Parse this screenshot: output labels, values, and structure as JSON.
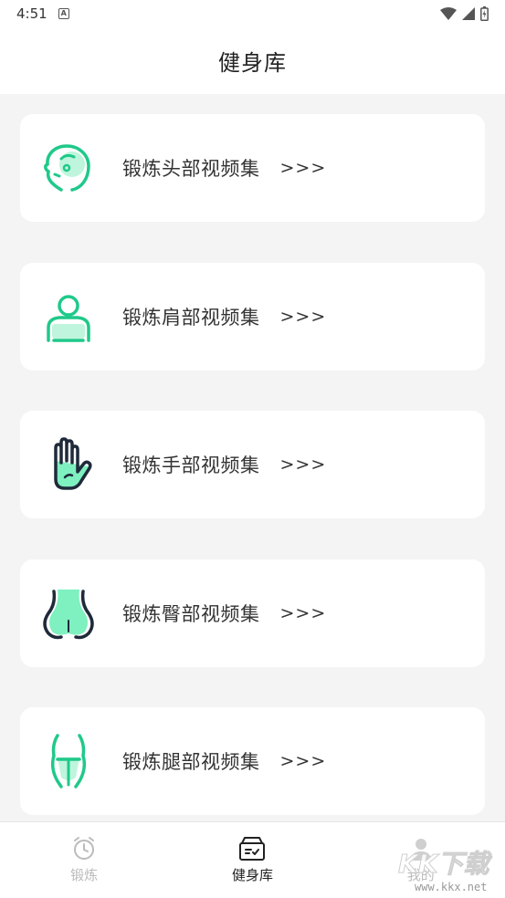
{
  "status_bar": {
    "time": "4:51",
    "badge": "A"
  },
  "header": {
    "title": "健身库"
  },
  "cards": [
    {
      "label": "锻炼头部视频集",
      "arrow": ">>>",
      "icon": "head-icon"
    },
    {
      "label": "锻炼肩部视频集",
      "arrow": ">>>",
      "icon": "shoulder-icon"
    },
    {
      "label": "锻炼手部视频集",
      "arrow": ">>>",
      "icon": "hand-icon"
    },
    {
      "label": "锻炼臀部视频集",
      "arrow": ">>>",
      "icon": "hip-icon"
    },
    {
      "label": "锻炼腿部视频集",
      "arrow": ">>>",
      "icon": "leg-icon"
    }
  ],
  "tabs": [
    {
      "label": "锻炼",
      "icon": "alarm-clock-icon",
      "active": false
    },
    {
      "label": "健身库",
      "icon": "library-box-icon",
      "active": true
    },
    {
      "label": "我的",
      "icon": "user-icon",
      "active": false
    }
  ],
  "watermark": {
    "text": "KK下载",
    "url": "www.kkx.net"
  },
  "colors": {
    "accent": "#1fc98a",
    "accent_light": "#7ff0c0",
    "dark": "#1f2a3a"
  }
}
